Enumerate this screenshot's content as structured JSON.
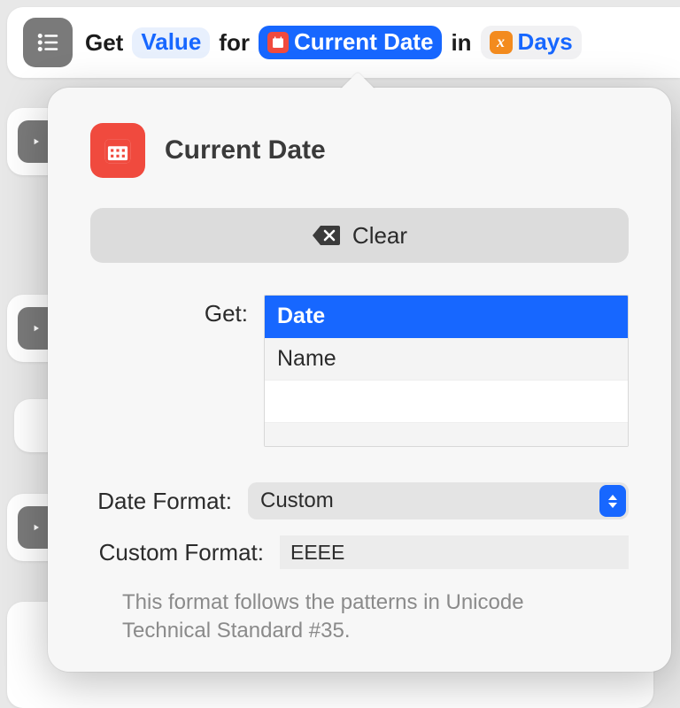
{
  "action_row": {
    "word_get": "Get",
    "value_pill": "Value",
    "word_for": "for",
    "current_date_pill": "Current Date",
    "word_in": "in",
    "days_pill": "Days",
    "lead_icon": "list-icon",
    "calendar_mini_icon": "calendar-icon",
    "variable_icon": "variable-x-icon"
  },
  "popover": {
    "title": "Current Date",
    "clear_label": "Clear",
    "get_label": "Get:",
    "get_options": [
      "Date",
      "Name"
    ],
    "get_selected_index": 0,
    "date_format_label": "Date Format:",
    "date_format_value": "Custom",
    "custom_format_label": "Custom Format:",
    "custom_format_value": "EEEE",
    "hint": "This format follows the patterns in Unicode Technical Standard #35."
  },
  "icons": {
    "clear_icon": "backspace-x-icon",
    "select_stepper": "up-down-chevron-icon",
    "branch_icon": "branch-icon"
  }
}
